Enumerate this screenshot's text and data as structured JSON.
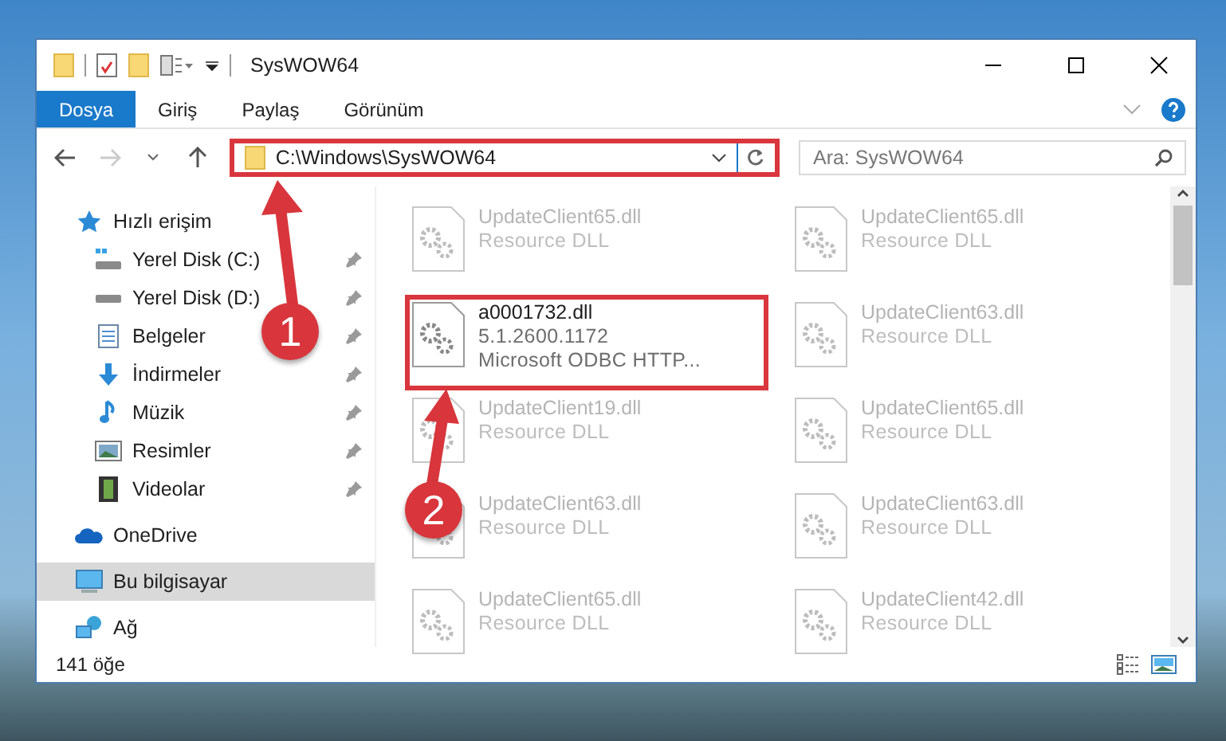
{
  "window": {
    "title": "SysWOW64"
  },
  "ribbon_tabs": [
    {
      "label": "Dosya",
      "selected": true
    },
    {
      "label": "Giriş",
      "selected": false
    },
    {
      "label": "Paylaş",
      "selected": false
    },
    {
      "label": "Görünüm",
      "selected": false
    }
  ],
  "address": {
    "path": "C:\\Windows\\SysWOW64",
    "highlighted": true
  },
  "search": {
    "placeholder": "Ara: SysWOW64"
  },
  "nav": [
    {
      "label": "Hızlı erişim",
      "kind": "star",
      "selected": false,
      "children": [
        {
          "label": "Yerel Disk (C:)",
          "kind": "system-drive",
          "selected": false,
          "pinned": true
        },
        {
          "label": "Yerel Disk (D:)",
          "kind": "drive",
          "selected": false,
          "pinned": true
        },
        {
          "label": "Belgeler",
          "kind": "documents",
          "selected": false,
          "pinned": true
        },
        {
          "label": "İndirmeler",
          "kind": "downloads",
          "selected": false,
          "pinned": true
        },
        {
          "label": "Müzik",
          "kind": "music",
          "selected": false,
          "pinned": true
        },
        {
          "label": "Resimler",
          "kind": "pictures",
          "selected": false,
          "pinned": true
        },
        {
          "label": "Videolar",
          "kind": "videos",
          "selected": false,
          "pinned": true
        }
      ]
    },
    {
      "label": "OneDrive",
      "kind": "cloud",
      "selected": false
    },
    {
      "label": "Bu bilgisayar",
      "kind": "computer",
      "selected": true
    },
    {
      "label": "Ağ",
      "kind": "network",
      "selected": false
    }
  ],
  "files": [
    {
      "name": "UpdateClient65.dll",
      "lines": [
        "Resource DLL"
      ],
      "dimmed": true,
      "highlighted": false
    },
    {
      "name": "UpdateClient65.dll",
      "lines": [
        "Resource DLL"
      ],
      "dimmed": true,
      "highlighted": false
    },
    {
      "name": "a0001732.dll",
      "lines": [
        "5.1.2600.1172",
        "Microsoft ODBC HTTP..."
      ],
      "dimmed": false,
      "highlighted": true
    },
    {
      "name": "UpdateClient63.dll",
      "lines": [
        "Resource DLL"
      ],
      "dimmed": true,
      "highlighted": false
    },
    {
      "name": "UpdateClient19.dll",
      "lines": [
        "Resource DLL"
      ],
      "dimmed": true,
      "highlighted": false
    },
    {
      "name": "UpdateClient65.dll",
      "lines": [
        "Resource DLL"
      ],
      "dimmed": true,
      "highlighted": false
    },
    {
      "name": "UpdateClient63.dll",
      "lines": [
        "Resource DLL"
      ],
      "dimmed": true,
      "highlighted": false
    },
    {
      "name": "UpdateClient63.dll",
      "lines": [
        "Resource DLL"
      ],
      "dimmed": true,
      "highlighted": false
    },
    {
      "name": "UpdateClient65.dll",
      "lines": [
        "Resource DLL"
      ],
      "dimmed": true,
      "highlighted": false
    },
    {
      "name": "UpdateClient42.dll",
      "lines": [
        "Resource DLL"
      ],
      "dimmed": true,
      "highlighted": false
    }
  ],
  "status_bar": {
    "count": "141 öğe"
  },
  "annotations": [
    {
      "number": "1"
    },
    {
      "number": "2"
    }
  ]
}
